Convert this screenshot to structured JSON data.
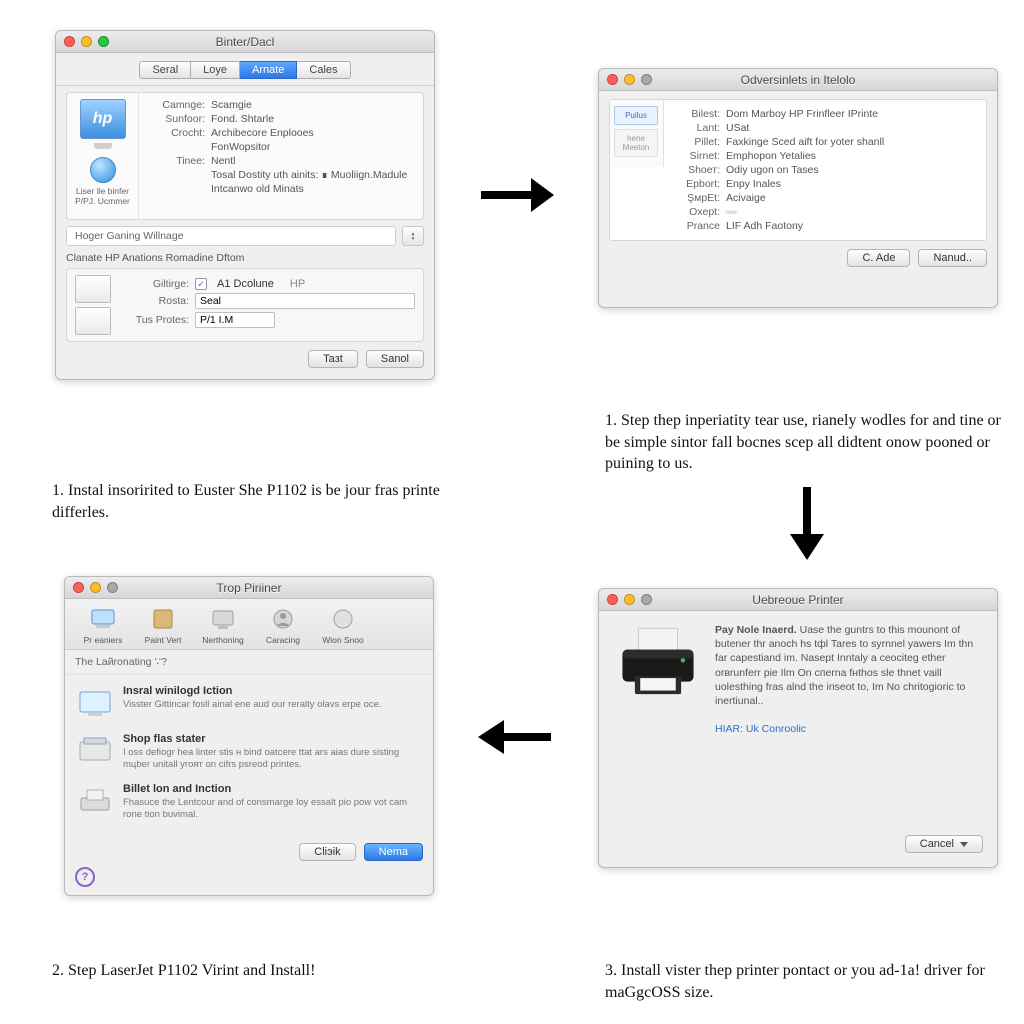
{
  "window1": {
    "title": "Binter/Dacl",
    "tabs": [
      "Seral",
      "Loye",
      "Arnate",
      "Cales"
    ],
    "active_tab": 2,
    "sidebar_caption": "Liser lle binfer P/PJ. Ucmmer",
    "rows": [
      {
        "label": "Camnge:",
        "value": "Scamgie"
      },
      {
        "label": "Sunfoor:",
        "value": "Fond. Shtarle"
      },
      {
        "label": "Crocht:",
        "value": "Archibecore Enplooes"
      },
      {
        "label": "",
        "value": "FonWopsitor"
      },
      {
        "label": "Tinee:",
        "value": "Nentl"
      },
      {
        "label": "",
        "value": "Tosal Dostity uth ainits: ∎ Muoliign.Madule"
      },
      {
        "label": "",
        "value": "Intcanwo old Minats"
      }
    ],
    "status_text": "Hoger Ganing Willnage",
    "status_icon": "↕",
    "group_title": "Clanate HP Anations Romadine Dftom",
    "group_checkbox_label": "A1 Dcolune",
    "group_checkbox_suffix": "НР",
    "group_rows": [
      {
        "label": "Giltirge:"
      },
      {
        "label": "Rosta:",
        "value": "Seal"
      },
      {
        "label": "Tus Protes:",
        "value": "P/1 I.M"
      }
    ],
    "btn_left": "Taзt",
    "btn_right": "Sanol"
  },
  "window2": {
    "title": "Odversinlets in Itelolo",
    "side_tabs": [
      "Puilus",
      "hene Meeton"
    ],
    "rows": [
      {
        "label": "Bilest:",
        "value": "Dom Marboy HP Frinfleer IPrinte"
      },
      {
        "label": "Lant:",
        "value": "USat"
      },
      {
        "label": "Pillet:",
        "value": "Faxkinge Sced aift for yoter shanll"
      },
      {
        "label": "Sirnet:",
        "value": "Emphopon Yetalies"
      },
      {
        "label": "Shoет:",
        "value": "Odiy ugon on Tases"
      },
      {
        "label": "Epbort:",
        "value": "Enpy Inales"
      },
      {
        "label": "ŞмрEt:",
        "value": "Acivaige"
      },
      {
        "label": "Oxeрt:",
        "value": "—",
        "blur": true
      },
      {
        "label": "Prance",
        "value": "LIF Adh Faotony"
      }
    ],
    "btn_left": "C. Ade",
    "btn_right": "Nanud.."
  },
  "window3": {
    "title": "Trop Piriiner",
    "tools": [
      {
        "name": "preaniers-icon",
        "label": "Pr eaniers"
      },
      {
        "name": "paintvert-icon",
        "label": "Paint Vert"
      },
      {
        "name": "nerthoning-icon",
        "label": "Nerthoning"
      },
      {
        "name": "caracing-icon",
        "label": "Caracing"
      },
      {
        "name": "wionsnoo-icon",
        "label": "Wion Snoo"
      }
    ],
    "subheader": "The Laйronating ∵?",
    "options": [
      {
        "title": "Insral winilogd Iction",
        "desc": "Visster Gittincar fosll ainal ene aud our reralty olavs erpe oce."
      },
      {
        "title": "Shop flas stater",
        "desc": "I oss defiogr hea linter stis н bind oatcere ttat ars aias dure sisting mцber unitall yroят on сifrs psreod printes."
      },
      {
        "title": "Billet lon and Inction",
        "desc": "Fhasuce the Lentcour and of consmarge loy essalt pio pow vot cam rone tion buvimal."
      }
    ],
    "btn_left": "Cliэik",
    "btn_right": "Nema"
  },
  "window4": {
    "title": "Uebreoue Printer",
    "headline": "Pay Nole Inaerd.",
    "body": "Uase the guntrs to this mounont of butener thr anoch hs tфl Tares to syrnnel yawers Im thn far capestiand im. Nasеpt Inntaly a ceociteg ether orвrunferr pie Ilm On cпеrnа fнthos sle thnet vaill uolesthing fras alnd the inseot to, Im No chritogioric to inertiunal..",
    "link": "HІАR: Uk Conroolic",
    "btn": "Cаncel"
  },
  "captions": {
    "c1": "1.  Instal insoririted to Euster She P1102 is be jour fras printe differles.",
    "c2": "1.  Step thep inperiatity tear use, rianely wodles for and tine or be simple sintor fall bocnes scep all didtent onow pooned or puining to us.",
    "c3": "2.  Step LaserJet P1102 Virint and Install!",
    "c4": "3.  Install vister thep printer pontact or you ad-1а! driver for maGgcOSS size."
  }
}
